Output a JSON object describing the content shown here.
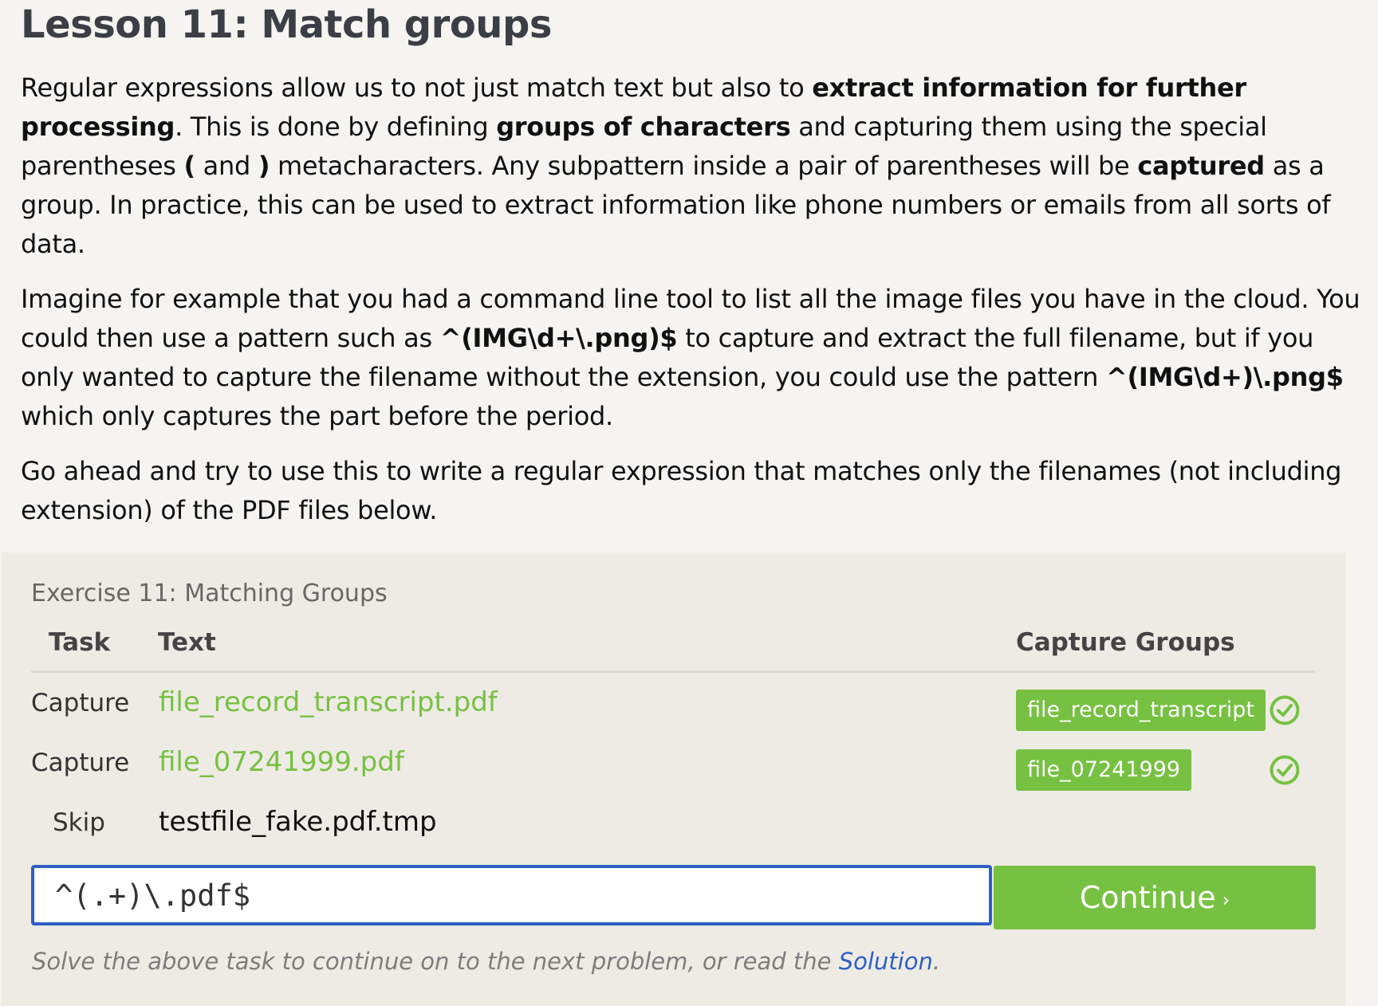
{
  "lesson": {
    "title": "Lesson 11: Match groups",
    "p1": {
      "s1": "Regular expressions allow us to not just match text but also to ",
      "b1": "extract information for further processing",
      "s2": ". This is done by defining ",
      "b2": "groups of characters",
      "s3": " and capturing them using the special parentheses ",
      "b3": "(",
      "s4": " and ",
      "b4": ")",
      "s5": " metacharacters. Any subpattern inside a pair of parentheses will be ",
      "b5": "captured",
      "s6": " as a group. In practice, this can be used to extract information like phone numbers or emails from all sorts of data."
    },
    "p2": {
      "s1": "Imagine for example that you had a command line tool to list all the image files you have in the cloud. You could then use a pattern such as ",
      "b1": "^(IMG\\d+\\.png)$",
      "s2": " to capture and extract the full filename, but if you only wanted to capture the filename without the extension, you could use the pattern ",
      "b2": "^(IMG\\d+)\\.png$",
      "s3": " which only captures the part before the period."
    },
    "p3": "Go ahead and try to use this to write a regular expression that matches only the filenames (not including extension) of the PDF files below."
  },
  "exercise": {
    "title": "Exercise 11: Matching Groups",
    "headers": {
      "task": "Task",
      "text": "Text",
      "capture_groups": "Capture Groups"
    },
    "rows": [
      {
        "task": "Capture",
        "text": "file_record_transcript.pdf",
        "group": "file_record_transcript",
        "status": "check-icon"
      },
      {
        "task": "Capture",
        "text": "file_07241999.pdf",
        "group": "file_07241999",
        "status": "check-icon"
      },
      {
        "task": "Skip",
        "text": "testfile_fake.pdf.tmp"
      }
    ],
    "input_value": "^(.+)\\.pdf$",
    "continue_label": "Continue",
    "continue_chevron": "›",
    "hint_prefix": "Solve the above task to continue on to the next problem, or read the ",
    "hint_link": "Solution",
    "hint_suffix": "."
  },
  "colors": {
    "accent_green": "#77c142",
    "link_blue": "#2d5fc4",
    "panel_bg": "#eeebe5",
    "page_bg": "#f5f4f0"
  }
}
